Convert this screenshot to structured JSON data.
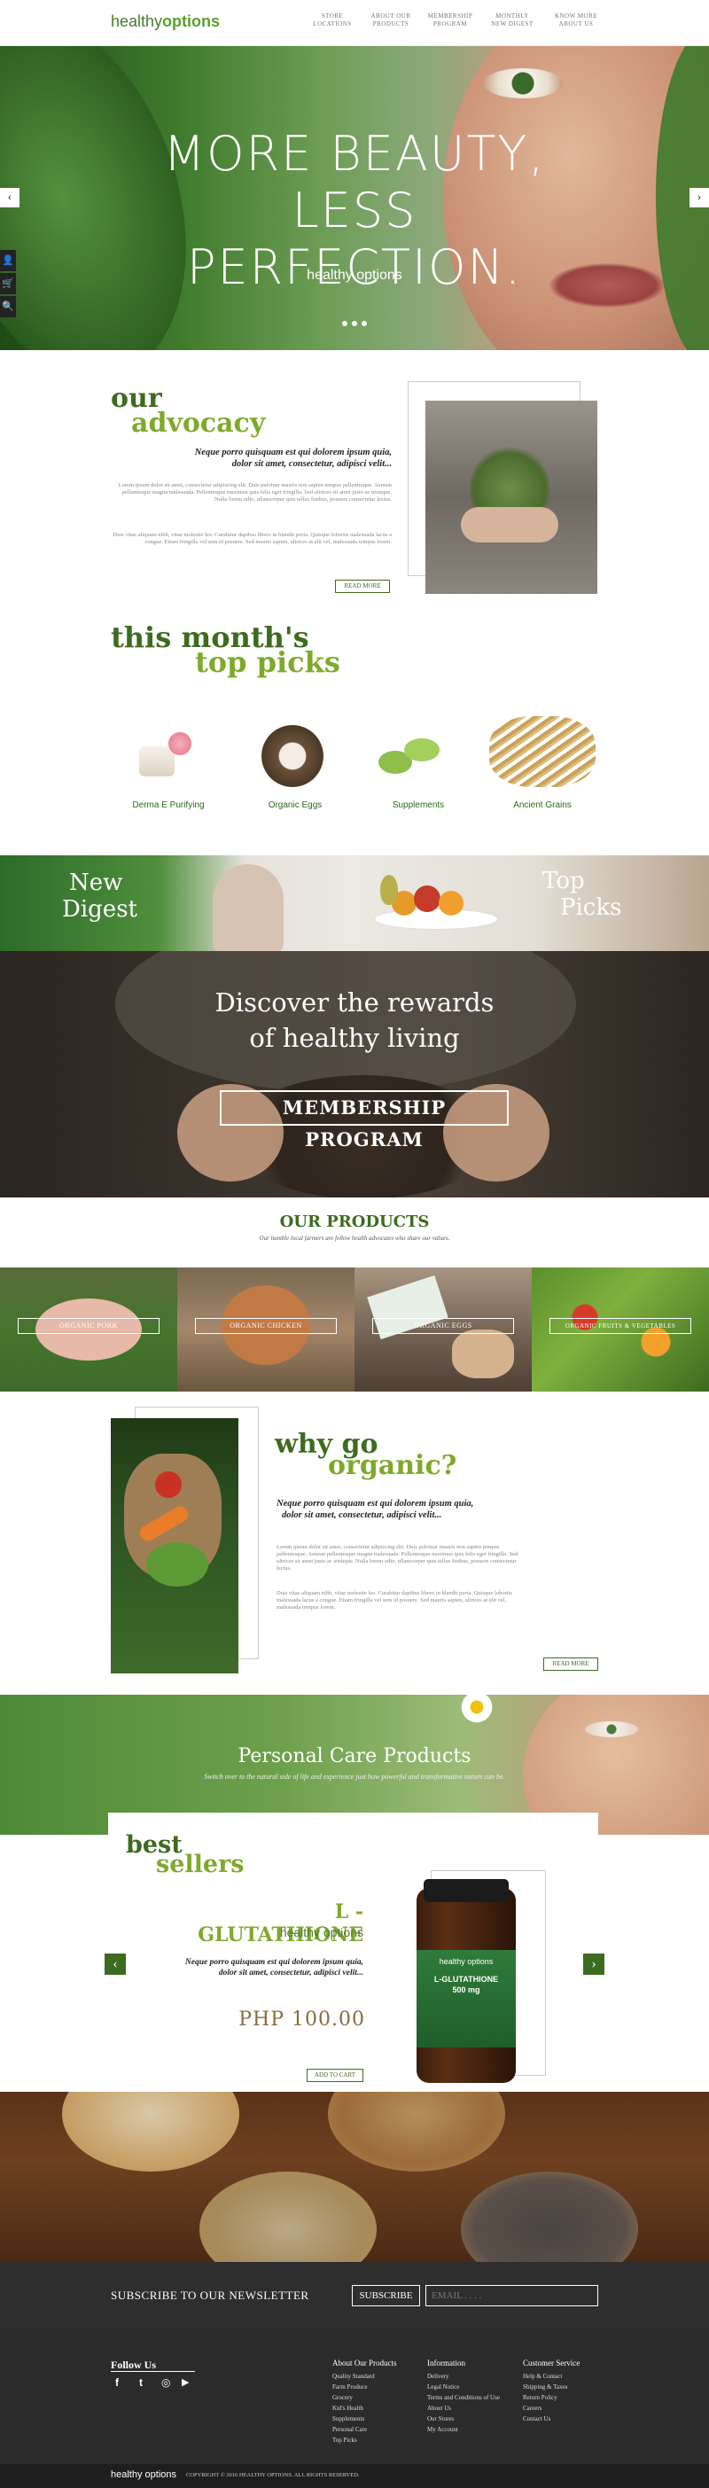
{
  "header": {
    "logo_text": "healthy",
    "logo_text_bold": "options",
    "nav": [
      {
        "line1": "STORE",
        "line2": "LOCATIONS"
      },
      {
        "line1": "ABOUT OUR",
        "line2": "PRODUCTS"
      },
      {
        "line1": "MEMBERSHIP",
        "line2": "PROGRAM"
      },
      {
        "line1": "MONTHLY",
        "line2": "NEW DIGEST"
      },
      {
        "line1": "KNOW MORE",
        "line2": "ABOUT US"
      }
    ]
  },
  "hero": {
    "title_line1": "MORE BEAUTY,",
    "title_line2": "LESS PERFECTION.",
    "brand": "healthy options",
    "prev_icon": "‹",
    "next_icon": "›"
  },
  "sidebar_tools": {
    "user_icon": "👤",
    "cart_icon": "🛒",
    "search_icon": "🔍"
  },
  "advocacy": {
    "heading1": "our",
    "heading2": "advocacy",
    "quote_line1": "Neque porro quisquam est qui dolorem ipsum quia,",
    "quote_line2": "dolor sit amet, consectetur, adipisci velit...",
    "body1": "Lorem ipsum dolor sit amet, consectetur adipiscing elit. Duis pulvinar mauris non sapien tempus pellentesque. Aenean pellentesque magna malesuada. Pellentesque maximus quis felis eget fringilla. Sed ultrices sit amet justo ac tristique. Nulla lorem odio, ullamcorper quis tellus finibus, posuere consectetur lectus.",
    "body2": "Duis vitae aliquam nibh, vitae molestie leo. Curabitur dapibus libero in blandit porta. Quisque lobortis malesuada lacus a congue. Etiam fringilla vel sem id posuere. Sed mauris sapien, ultrices at elit vel, malesuada tempus lorem.",
    "read_more": "READ MORE"
  },
  "top_picks": {
    "heading1": "this month's",
    "heading2": "top picks",
    "items": [
      {
        "label": "Derma E Purifying"
      },
      {
        "label": "Organic Eggs"
      },
      {
        "label": "Supplements"
      },
      {
        "label": "Ancient Grains"
      }
    ]
  },
  "banners": {
    "digest_line1": "New",
    "digest_line2": "Digest",
    "picks_line1": "Top",
    "picks_line2": "Picks"
  },
  "membership": {
    "line1": "Discover the rewards",
    "line2": "of healthy living",
    "button": "MEMBERSHIP PROGRAM"
  },
  "our_products": {
    "heading": "OUR PRODUCTS",
    "subtitle": "Our humble local farmers are fellow health advocates who share our values.",
    "tiles": [
      {
        "label": "ORGANIC PORK"
      },
      {
        "label": "ORGANIC CHICKEN"
      },
      {
        "label": "ORGANIC EGGS"
      },
      {
        "label": "ORGANIC FRUITS & VEGETABLES"
      }
    ]
  },
  "why_organic": {
    "heading1": "why go",
    "heading2": "organic?",
    "quote_line1": "Neque porro quisquam est qui dolorem ipsum quia,",
    "quote_line2": "dolor sit amet, consectetur, adipisci velit...",
    "body1": "Lorem ipsum dolor sit amet, consectetur adipiscing elit. Duis pulvinar mauris non sapien tempus pellentesque. Aenean pellentesque magna malesuada. Pellentesque maximus quis felis eget fringilla. Sed ultrices sit amet justo ac tristique. Nulla lorem odio, ullamcorper quis tellus finibus, posuere consectetur lectus.",
    "body2": "Duis vitae aliquam nibh, vitae molestie leo. Curabitur dapibus libero in blandit porta. Quisque lobortis malesuada lacus a congue. Etiam fringilla vel sem id posuere. Sed mauris sapien, ultrices at elit vel, malesuada tempus lorem.",
    "read_more": "READ MORE"
  },
  "personal_care": {
    "title": "Personal Care Products",
    "subtitle": "Switch over to the natural side of life and experience just how powerful and transformative nature can be."
  },
  "best_sellers": {
    "heading1": "best",
    "heading2": "sellers",
    "product_name": "L - GLUTATHIONE",
    "brand": "healthy options",
    "quote_line1": "Neque porro quisquam est qui dolorem ipsum quia,",
    "quote_line2": "dolor sit amet, consectetur, adipisci velit...",
    "price": "PHP 100.00",
    "add_to_cart": "ADD TO CART",
    "bottle_brand": "healthy options",
    "bottle_name": "L-GLUTATHIONE",
    "bottle_dose": "500 mg",
    "prev_icon": "‹",
    "next_icon": "›"
  },
  "newsletter": {
    "label": "SUBSCRIBE TO OUR NEWSLETTER",
    "button": "SUBSCRIBE",
    "placeholder": "EMAIL . . . ."
  },
  "footer": {
    "follow": "Follow Us",
    "social": [
      "f",
      "t",
      "◎",
      "▶"
    ],
    "col1_title": "About Our Products",
    "col1": [
      "Quality Standard",
      "Farm Produce",
      "Grocery",
      "Kid's Health",
      "Supplements",
      "Personal Care",
      "Top Picks"
    ],
    "col2_title": "Information",
    "col2": [
      "Delivery",
      "Legal Notice",
      "Terms and Conditions of Use",
      "About Us",
      "Our Stores",
      "My Account"
    ],
    "col3_title": "Customer Service",
    "col3": [
      "Help & Contact",
      "Shipping & Taxes",
      "Return Policy",
      "Careers",
      "Contact Us"
    ],
    "copyright_logo": "healthy options",
    "copyright": "COPYRIGHT © 2016 HEALTHY OPTIONS. ALL RIGHTS RESERVED."
  },
  "colors": {
    "primary_green": "#3d6b1f",
    "lime": "#7fa92b",
    "footer_bg": "#2b2b2b"
  }
}
